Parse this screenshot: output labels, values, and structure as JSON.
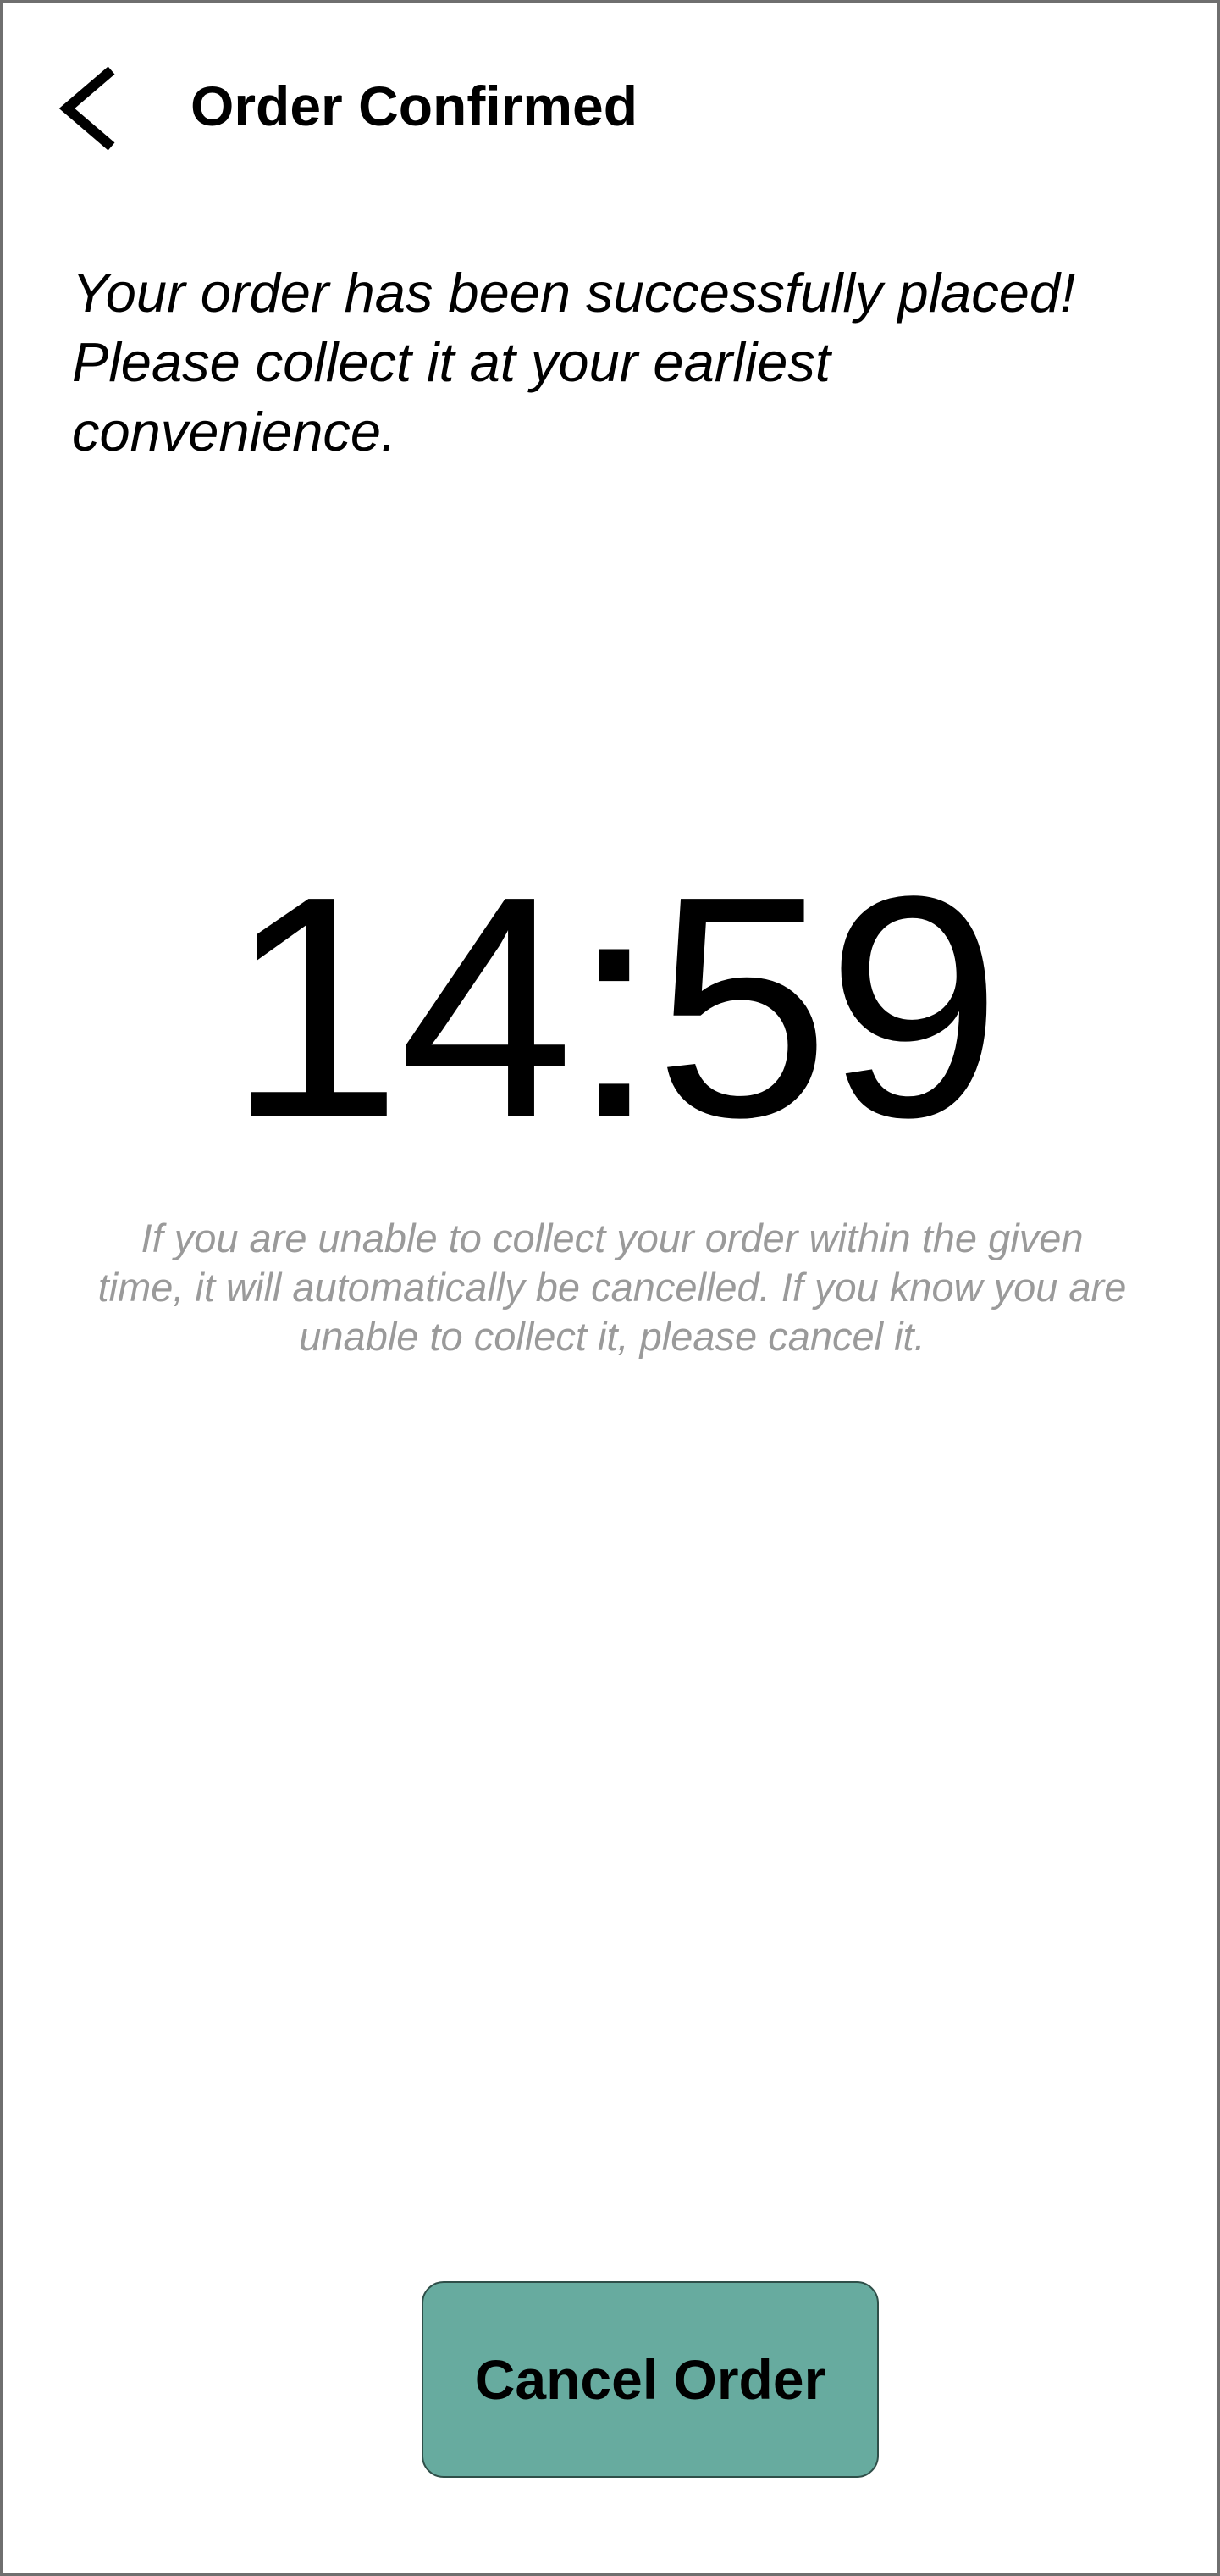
{
  "header": {
    "back_icon": "chevron-left-icon",
    "title": "Order Confirmed"
  },
  "main": {
    "message": "Your order has been successfully placed! Please collect it at your earliest convenience.",
    "countdown": "14:59",
    "notice": "If you are unable to collect your order within the given time, it will automatically be cancelled. If you know you are unable to collect it, please cancel it."
  },
  "footer": {
    "cancel_label": "Cancel Order",
    "cancel_color": "#67ab9f"
  }
}
